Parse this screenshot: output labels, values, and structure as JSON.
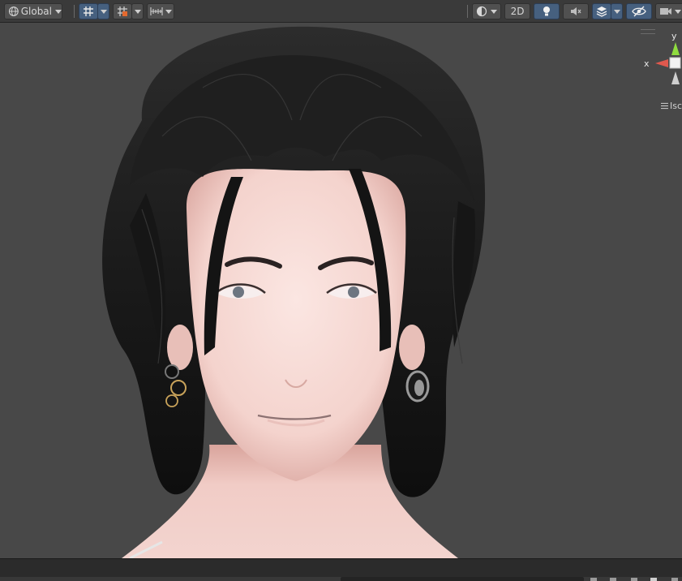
{
  "toolbar": {
    "pivot_rotation_label": "Global",
    "mode_2d_label": "2D",
    "icons": [
      "globe-icon",
      "grid-snap-icon",
      "increment-snap-icon",
      "ruler-icon",
      "shading-mode-icon",
      "lighting-icon",
      "audio-icon",
      "effects-icon",
      "scene-visibility-icon",
      "camera-icon"
    ]
  },
  "gizmo": {
    "y_label": "y",
    "x_label": "x",
    "projection_label": "Isc"
  },
  "colors": {
    "toolbar_bg": "#3a3a3a",
    "active_button": "#46607f",
    "scene_bg": "#484848",
    "gizmo_x": "#e0594e",
    "gizmo_y": "#8fdc3f"
  }
}
